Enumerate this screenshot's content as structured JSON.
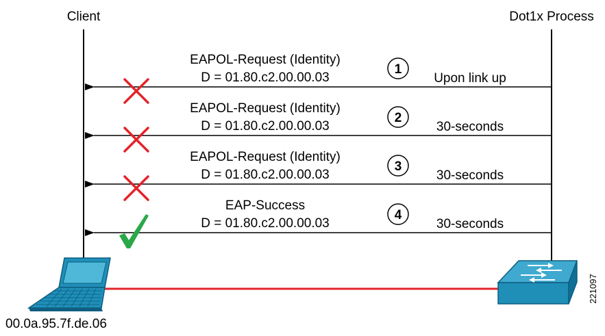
{
  "participants": {
    "client": "Client",
    "process": "Dot1x Process"
  },
  "messages": [
    {
      "step": "1",
      "title": "EAPOL-Request (Identity)",
      "dest": "D = 01.80.c2.00.00.03",
      "timing": "Upon link up",
      "outcome": "fail"
    },
    {
      "step": "2",
      "title": "EAPOL-Request (Identity)",
      "dest": "D = 01.80.c2.00.00.03",
      "timing": "30-seconds",
      "outcome": "fail"
    },
    {
      "step": "3",
      "title": "EAPOL-Request (Identity)",
      "dest": "D = 01.80.c2.00.00.03",
      "timing": "30-seconds",
      "outcome": "fail"
    },
    {
      "step": "4",
      "title": "EAP-Success",
      "dest": "D = 01.80.c2.00.00.03",
      "timing": "30-seconds",
      "outcome": "success"
    }
  ],
  "client_mac": "00.0a.95.7f.de.06",
  "figure_id": "221097",
  "colors": {
    "fail_mark": "#e2242a",
    "success_mark": "#2aa84a",
    "link": "#e2242a",
    "device_fill": "#1f8fb8",
    "device_dark": "#0f5e80"
  },
  "icons": {
    "client_device": "laptop-icon",
    "process_device": "switch-icon"
  }
}
